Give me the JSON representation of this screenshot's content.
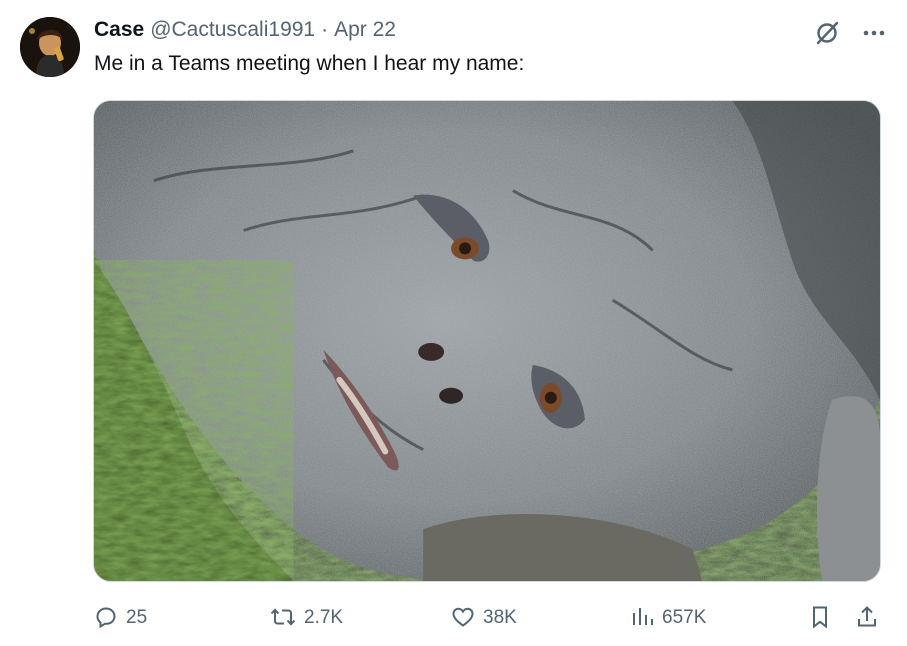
{
  "post": {
    "display_name": "Case",
    "handle": "@Cactuscali1991",
    "separator": "·",
    "date": "Apr 22",
    "text": "Me in a Teams meeting when I hear my name:"
  },
  "icons": {
    "avatar": "avatar",
    "grok": "grok-icon",
    "more": "more-icon",
    "reply": "reply-icon",
    "repost": "repost-icon",
    "like": "heart-icon",
    "views": "views-icon",
    "bookmark": "bookmark-icon",
    "share": "share-icon"
  },
  "actions": {
    "replies": "25",
    "reposts": "2.7K",
    "likes": "38K",
    "views": "657K"
  },
  "colors": {
    "text_primary": "#0f1419",
    "text_secondary": "#536471",
    "border": "#cfd9de"
  }
}
